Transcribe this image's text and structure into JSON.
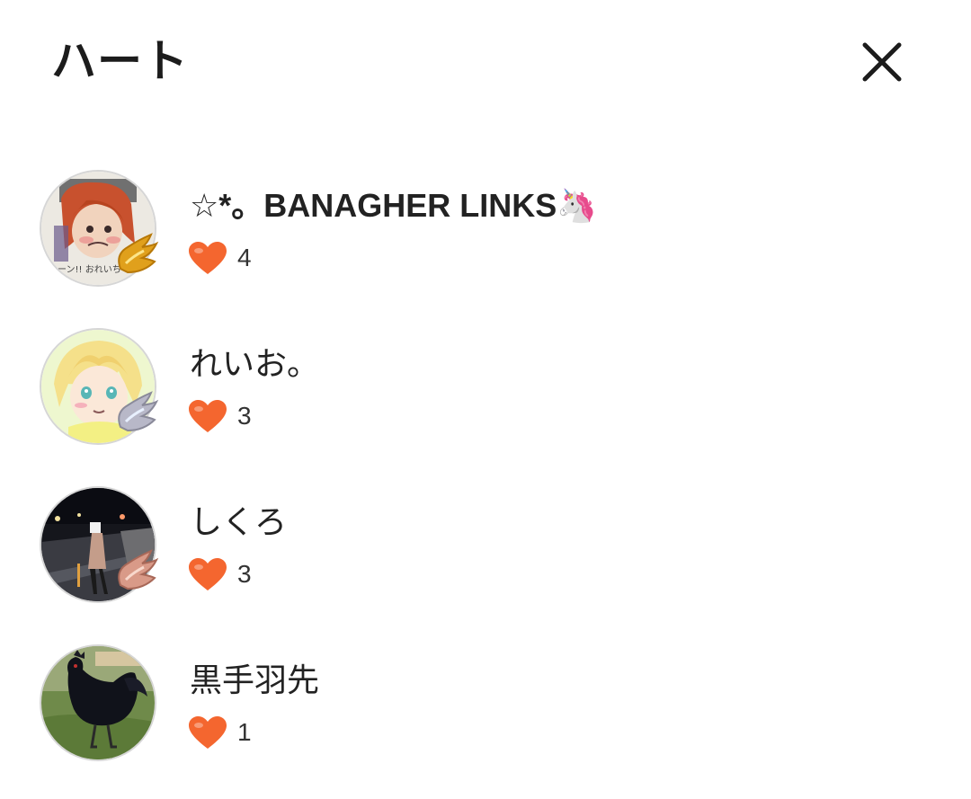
{
  "header": {
    "title": "ハート",
    "close_icon": "close-icon"
  },
  "colors": {
    "heart": "#f4662f",
    "text": "#222222",
    "avatar_border": "#d6d6d6"
  },
  "likers": [
    {
      "name": "☆*。BANAGHER LINKS🦄",
      "heart_icon": "heart-icon",
      "count": "4",
      "badge": "gold-wing-badge"
    },
    {
      "name": "れいお。",
      "heart_icon": "heart-icon",
      "count": "3",
      "badge": "silver-wing-badge"
    },
    {
      "name": "しくろ",
      "heart_icon": "heart-icon",
      "count": "3",
      "badge": "bronze-wing-badge"
    },
    {
      "name": "黒手羽先",
      "heart_icon": "heart-icon",
      "count": "1",
      "badge": ""
    }
  ]
}
